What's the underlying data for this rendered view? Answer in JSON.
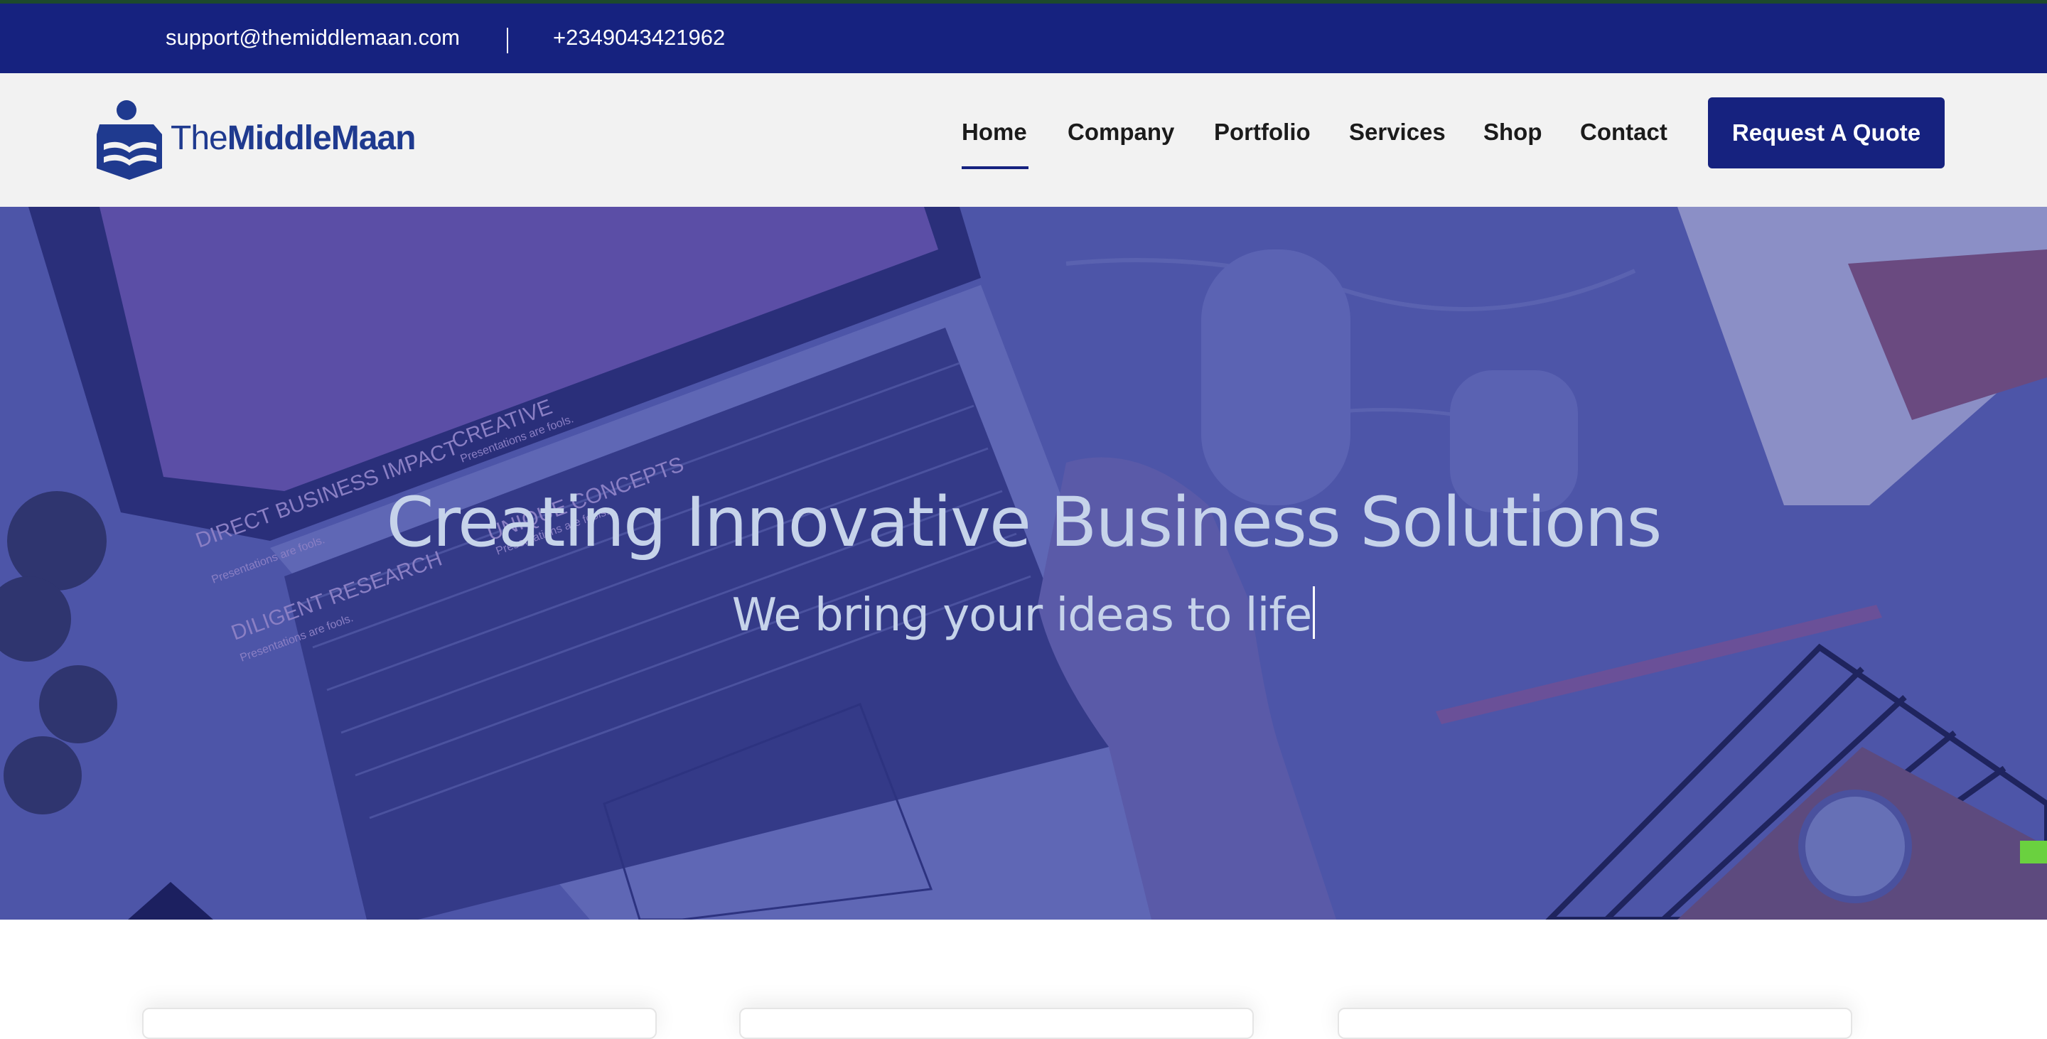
{
  "topbar": {
    "email": "support@themiddlemaan.com",
    "phone": "+2349043421962"
  },
  "brand": {
    "name_light": "The",
    "name_bold": "MiddleMaan",
    "logo_icon": "handshake-logo-icon"
  },
  "nav": {
    "items": [
      {
        "label": "Home",
        "active": true
      },
      {
        "label": "Company",
        "active": false
      },
      {
        "label": "Portfolio",
        "active": false
      },
      {
        "label": "Services",
        "active": false
      },
      {
        "label": "Shop",
        "active": false
      },
      {
        "label": "Contact",
        "active": false
      }
    ],
    "cta_label": "Request A Quote"
  },
  "hero": {
    "title": "Creating Innovative Business Solutions",
    "subtitle": "We bring your ideas to life",
    "screen_texts": [
      "DIRECT BUSINESS IMPACT",
      "Presentations are fools.",
      "DILIGENT RESEARCH",
      "Presentations are fools.",
      "CREATIVE",
      "Presentations are fools.",
      "UNIQUE CONCEPTS",
      "Presentations are fools."
    ]
  },
  "colors": {
    "brand_navy": "#16227f",
    "hero_overlay": "#4a52a4",
    "hero_text": "#c6d3ea",
    "accent_green": "#6ad13f"
  }
}
